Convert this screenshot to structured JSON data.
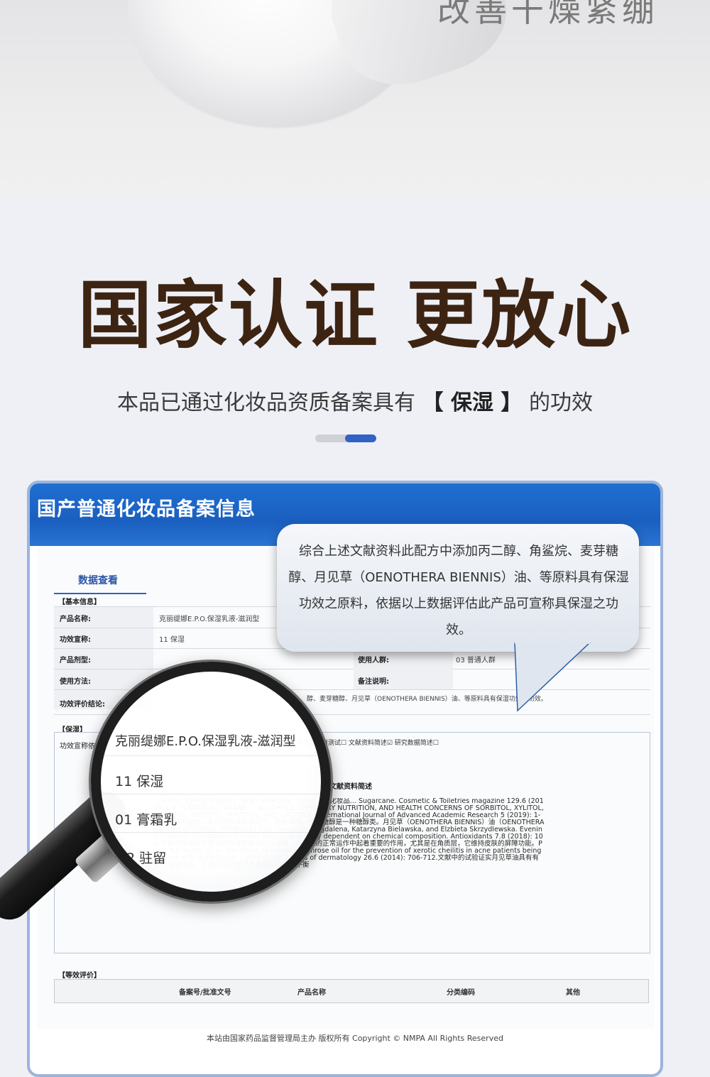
{
  "hero": {
    "slogan": "改善干燥紧绷"
  },
  "headline": "国家认证 更放心",
  "subline": {
    "prefix": "本品已通过化妆品资质备案具有",
    "highlight": "【 保湿 】",
    "suffix": "的功效"
  },
  "indicator": {
    "active_index": 2,
    "total": 2,
    "active_color": "#3262c4"
  },
  "card": {
    "title": "国产普通化妆品备案信息",
    "tab": "数据查看",
    "section_basic": "【基本信息】",
    "fields": [
      {
        "label": "产品名称:",
        "value": "克丽缇娜E.P.O.保湿乳液-滋润型"
      },
      {
        "label": "功效宣称:",
        "value": "11 保湿"
      },
      {
        "label": "产品剂型:",
        "value": ""
      },
      {
        "label": "使用方法:",
        "value": ""
      },
      {
        "label": "功效评价结论:",
        "value": "醇、麦芽糖醇、月见草（OENOTHERA BIENNIS）油、等原料具有保湿功效之功效。"
      }
    ],
    "right_fields": [
      {
        "label": "使用人群:",
        "value": "03 普通人群"
      },
      {
        "label": "备注说明:",
        "value": ""
      }
    ],
    "section_moist": "【保湿】",
    "claim_label": "功效宣称依据",
    "method_text": "人体使用测试☐ 消费者使用测试☐ 文献资料简述☑ 研究数据简述☐",
    "lit_title": "文献资料简述",
    "lit_body": "...7-491, 1994文中指出丙二醇是一种保湿剂，能防止干性化妆品... Sugarcane. Cosmetic & Toiletries magazine 129.6 (2014): 1-6. 文中提到 SQUALANE ... ALCOHOLS:CHEMISTRY NUTRITION, AND HEALTH CONCERNS OF SORBITOL, XYLITOL, MALTITOL, INOSITOL, MALTITOL, AND LACTITOL. International Journal of Advanced Academic Research 5 (2019): 1-33. 文献中提出，麦芽糖醇具有吸湿性，能够保湿。麦芽糖醇是一种糖醇类。月见草（OENOTHERA BIENNIS）油（OENOTHERA BIENNIS (EVENING PRIMROSE) OIL) Timoszuk, Magdalena, Katarzyna Bielawska, and Elzbieta Skrzydlewska. Evening primrose (Oenothera biennis) biological activity dependent on chemical composition. Antioxidants 7.8 (2018): 108.文献中指出月见草油能补充皮肤中的亚油酸，在皮肤的正常运作中起着重要的作用，尤其是在角质层，它维持皮肤的屏障功能。Park, Kui Young, et al. The effect of evening primrose oil for the prevention of xerotic cheilitis in acne patients being treated with isotretinoin: a pilot study. Annals of dermatology 26.6 (2014): 706-712.文献中的试验证实月见草油具有有益的保湿作用，补充月见草油可改善皮肤的水分平衡",
    "section_eval": "【等效评价】",
    "eval_columns": [
      "备案号/批准文号",
      "产品名称",
      "分类编码",
      "其他"
    ],
    "copyright": "本站由国家药品监督管理局主办 版权所有 Copyright © NMPA All Rights Reserved"
  },
  "bubble": {
    "text": "综合上述文献资料此配方中添加丙二醇、角鲨烷、麦芽糖醇、月见草（OENOTHERA BIENNIS）油、等原料具有保湿功效之原料，依据以上数据评估此产品可宣称具保湿之功效。"
  },
  "magnifier": {
    "rows": [
      "克丽缇娜E.P.O.保湿乳液-滋润型",
      "11 保湿",
      "01 膏霜乳",
      "2 驻留"
    ]
  }
}
